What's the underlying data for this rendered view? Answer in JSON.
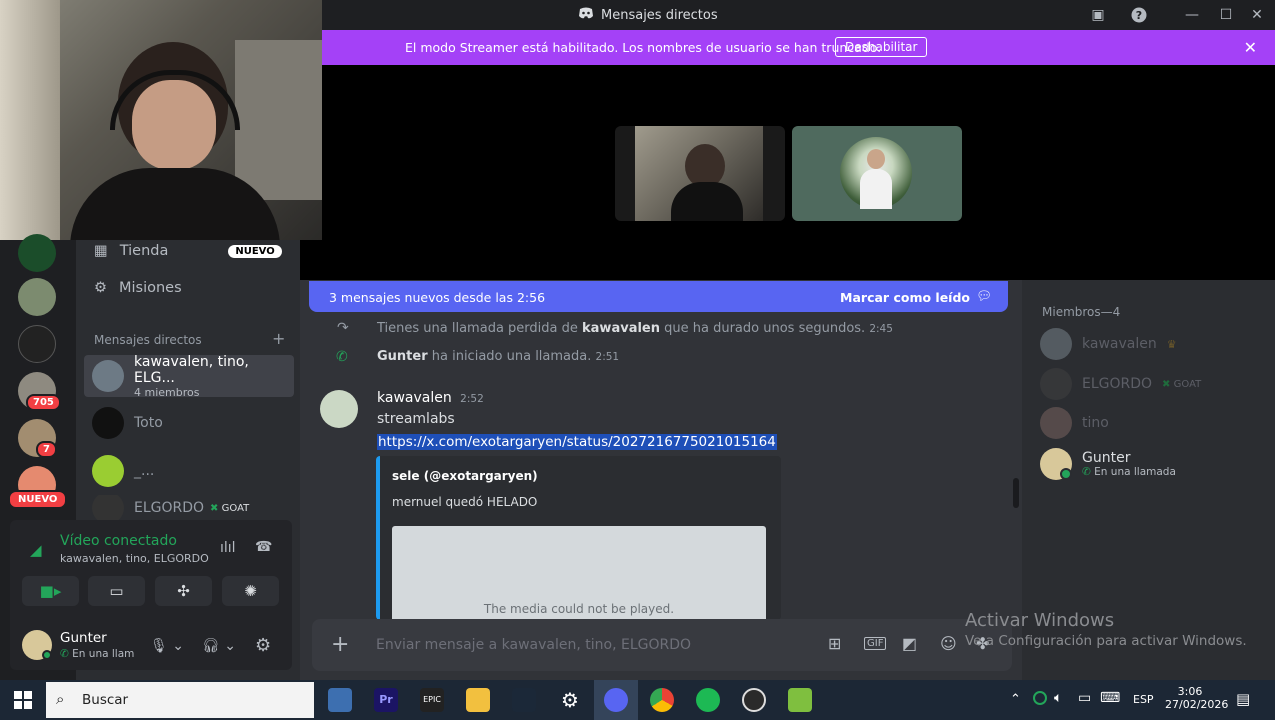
{
  "window": {
    "title": "Mensajes directos"
  },
  "banner": {
    "message": "El modo Streamer está habilitado. Los nombres de usuario se han truncado.",
    "button": "Deshabilitar"
  },
  "sidebar": {
    "nav": [
      {
        "label": "Tienda",
        "badge": "NUEVO"
      },
      {
        "label": "Misiones"
      }
    ],
    "dm_header": "Mensajes directos",
    "dms": [
      {
        "name": "kawavalen, tino, ELG...",
        "sub": "4 miembros"
      },
      {
        "name": "Toto"
      },
      {
        "name": "_..."
      },
      {
        "name": "ELGORDO",
        "tag": "GOAT"
      }
    ]
  },
  "servers": {
    "badges": [
      "705",
      "7"
    ],
    "new_label": "NUEVO"
  },
  "voice": {
    "status": "Vídeo conectado",
    "channel": "kawavalen, tino, ELGORDO"
  },
  "user": {
    "name": "Gunter",
    "status": "En una llam"
  },
  "chat": {
    "new_messages": "3 mensajes nuevos desde las 2:56",
    "mark_read": "Marcar como leído",
    "system1": {
      "pre": "Tienes una llamada perdida de ",
      "user": "kawavalen",
      "post": " que ha durado unos segundos.",
      "time": "2:45"
    },
    "system2": {
      "user": "Gunter",
      "post": " ha iniciado una llamada.",
      "time": "2:51"
    },
    "message": {
      "author": "kawavalen",
      "time": "2:52",
      "text": "streamlabs",
      "link": "https://x.com/exotargaryen/status/2027216775021015164"
    },
    "embed": {
      "author": "sele (@exotargaryen)",
      "text": "mernuel quedó HELADO",
      "media_error": "The media could not be played."
    },
    "composer_placeholder": "Enviar mensaje a kawavalen, tino, ELGORDO"
  },
  "members": {
    "header": "Miembros—4",
    "list": [
      {
        "name": "kawavalen"
      },
      {
        "name": "ELGORDO",
        "tag": "GOAT"
      },
      {
        "name": "tino"
      },
      {
        "name": "Gunter",
        "status": "En una llamada"
      }
    ]
  },
  "watermark": {
    "title": "Activar Windows",
    "sub": "Ve a Configuración para activar Windows."
  },
  "taskbar": {
    "search": "Buscar",
    "lang": "ESP",
    "time": "3:06",
    "date": "27/02/2026"
  },
  "colors": {
    "banner": "#a441f7",
    "blurple": "#5865f2",
    "green": "#23a55a",
    "link": "#00a8fc"
  }
}
